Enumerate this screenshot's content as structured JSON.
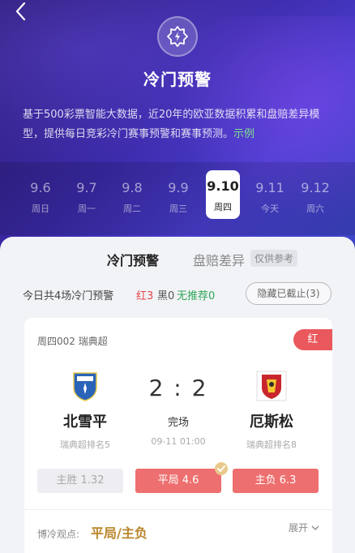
{
  "header": {
    "title": "冷门预警",
    "desc_main": "基于500彩票智能大数据，近20年的欧亚数据积累和盘赔差异模型，提供每日竞彩冷门赛事预警和赛事预测。",
    "desc_example": "示例"
  },
  "dates": [
    {
      "date": "9.6",
      "weekday": "周日"
    },
    {
      "date": "9.7",
      "weekday": "周一"
    },
    {
      "date": "9.8",
      "weekday": "周二"
    },
    {
      "date": "9.9",
      "weekday": "周三"
    },
    {
      "date": "9.10",
      "weekday": "周四",
      "active": true
    },
    {
      "date": "9.11",
      "weekday": "今天"
    },
    {
      "date": "9.12",
      "weekday": "周六"
    }
  ],
  "tabs": {
    "tab1": "冷门预警",
    "tab2": "盘赔差异",
    "ref_tag": "仅供参考"
  },
  "summary": {
    "text": "今日共4场冷门预警",
    "red": "红3",
    "black": "黑0",
    "none": "无推荐0",
    "hide_button": "隐藏已截止(3)"
  },
  "match": {
    "header": "周四002 瑞典超",
    "tag": "红",
    "home": {
      "name": "北雪平",
      "rank": "瑞典超排名5"
    },
    "away": {
      "name": "厄斯松",
      "rank": "瑞典超排名8"
    },
    "score": "2 : 2",
    "status": "完场",
    "time": "09-11 01:00",
    "odds": [
      "主胜 1.32",
      "平局 4.6",
      "主负 6.3"
    ],
    "view_label": "博冷观点:",
    "view_value": "平局/主负",
    "expand": "展开"
  },
  "colors": {
    "accent_red": "#ee6f6f",
    "green": "#7de08d",
    "gold": "#b9862b"
  }
}
